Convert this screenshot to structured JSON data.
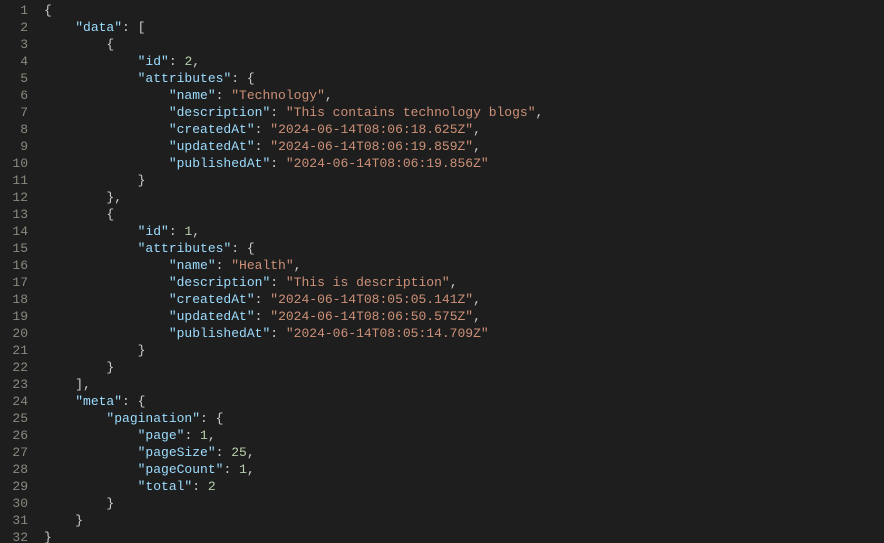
{
  "json": {
    "data": [
      {
        "id": 2,
        "attributes": {
          "name": "Technology",
          "description": "This contains technology blogs",
          "createdAt": "2024-06-14T08:06:18.625Z",
          "updatedAt": "2024-06-14T08:06:19.859Z",
          "publishedAt": "2024-06-14T08:06:19.856Z"
        }
      },
      {
        "id": 1,
        "attributes": {
          "name": "Health",
          "description": "This is description",
          "createdAt": "2024-06-14T08:05:05.141Z",
          "updatedAt": "2024-06-14T08:06:50.575Z",
          "publishedAt": "2024-06-14T08:05:14.709Z"
        }
      }
    ],
    "meta": {
      "pagination": {
        "page": 1,
        "pageSize": 25,
        "pageCount": 1,
        "total": 2
      }
    }
  },
  "lineCount": 32,
  "indentUnit": "    "
}
